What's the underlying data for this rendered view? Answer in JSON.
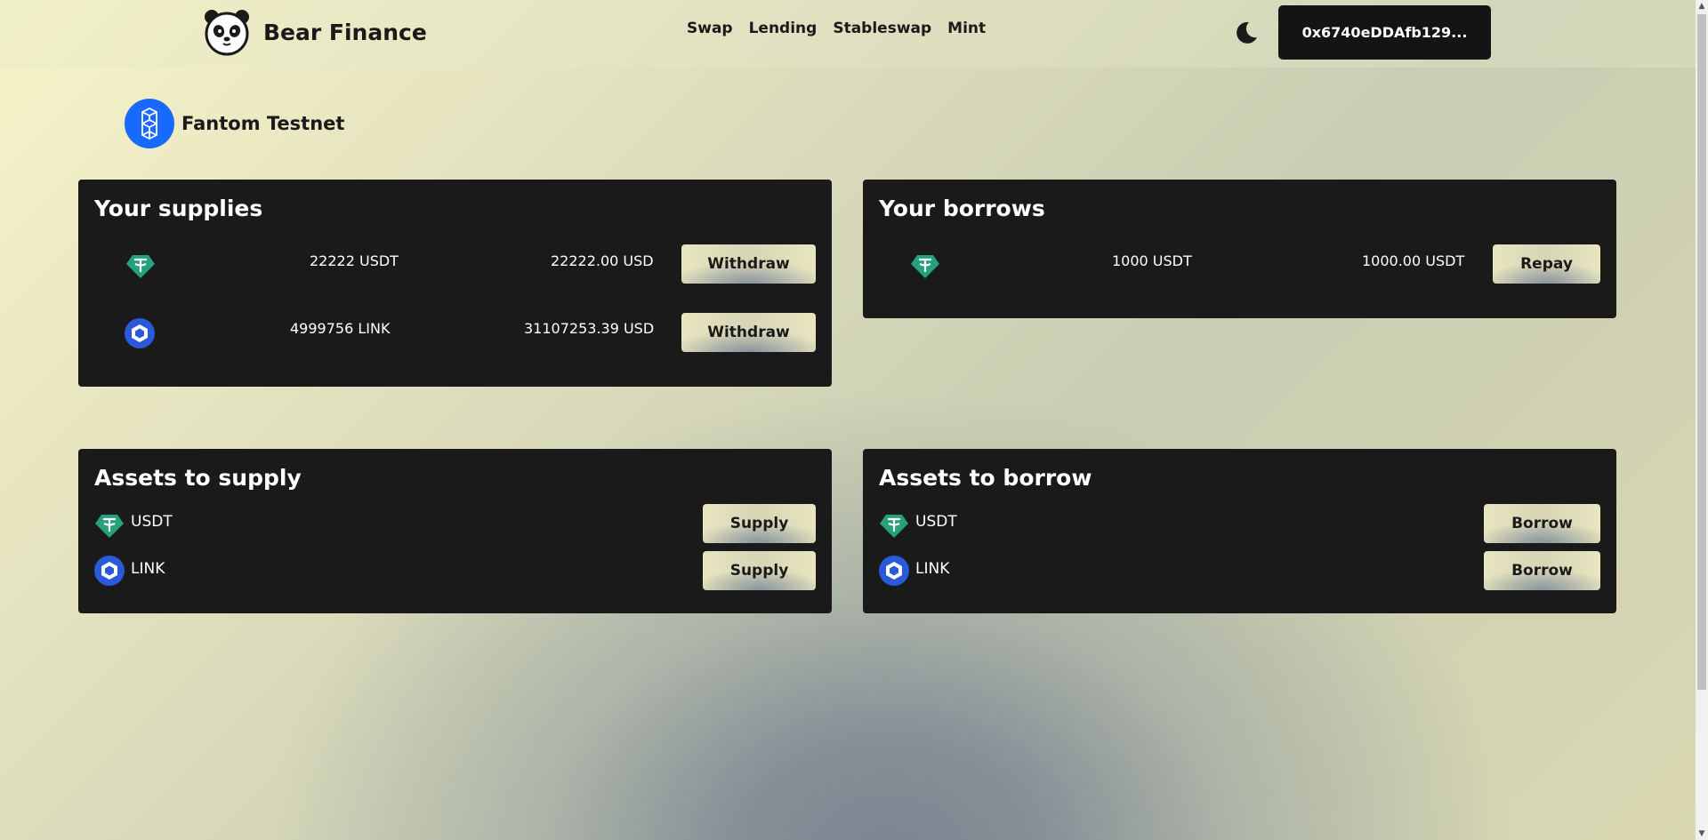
{
  "header": {
    "brand": "Bear Finance",
    "nav": [
      "Swap",
      "Lending",
      "Stableswap",
      "Mint"
    ],
    "wallet_address": "0x6740eDDAfb129..."
  },
  "network": {
    "name": "Fantom Testnet"
  },
  "supplies": {
    "title": "Your supplies",
    "rows": [
      {
        "icon": "usdt-icon",
        "amount": "22222 USDT",
        "value": "22222.00 USD",
        "action": "Withdraw"
      },
      {
        "icon": "link-icon",
        "amount": "4999756 LINK",
        "value": "31107253.39 USD",
        "action": "Withdraw"
      }
    ]
  },
  "borrows": {
    "title": "Your borrows",
    "rows": [
      {
        "icon": "usdt-icon",
        "amount": "1000 USDT",
        "value": "1000.00 USDT",
        "action": "Repay"
      }
    ]
  },
  "assets_supply": {
    "title": "Assets to supply",
    "rows": [
      {
        "icon": "usdt-icon",
        "symbol": "USDT",
        "action": "Supply"
      },
      {
        "icon": "link-icon",
        "symbol": "LINK",
        "action": "Supply"
      }
    ]
  },
  "assets_borrow": {
    "title": "Assets to borrow",
    "rows": [
      {
        "icon": "usdt-icon",
        "symbol": "USDT",
        "action": "Borrow"
      },
      {
        "icon": "link-icon",
        "symbol": "LINK",
        "action": "Borrow"
      }
    ]
  },
  "colors": {
    "panel": "#1a1a1a",
    "usdt": "#26a17b",
    "link": "#2a5ada",
    "fantom": "#1969ff"
  }
}
